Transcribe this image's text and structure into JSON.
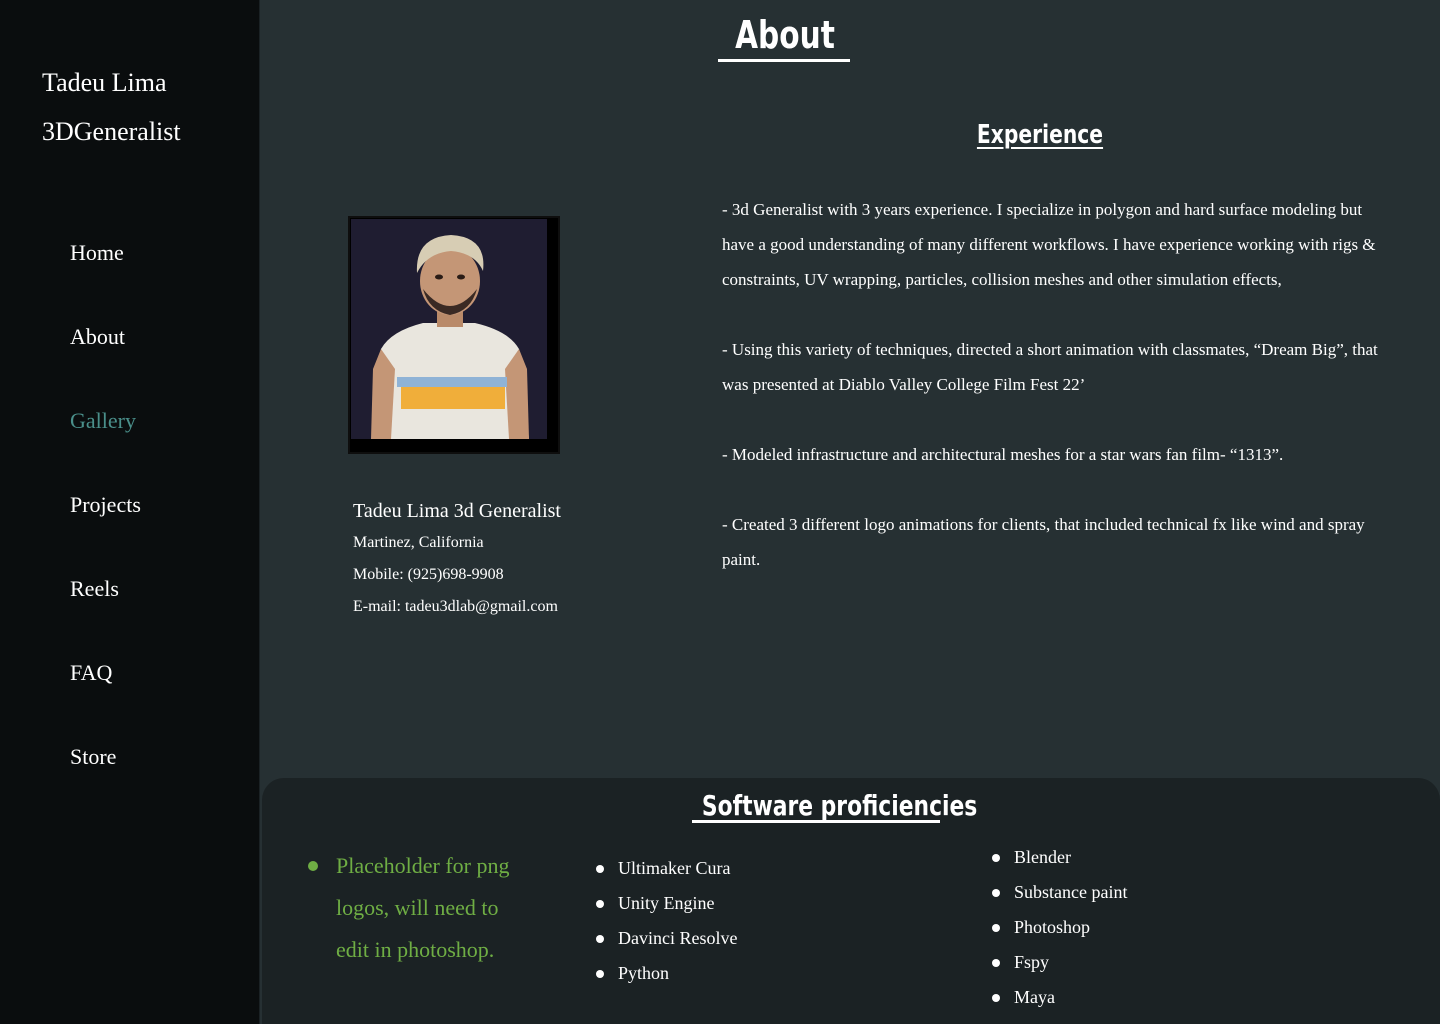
{
  "sidebar": {
    "brand": {
      "name": "Tadeu Lima",
      "tagline": "3DGeneralist"
    },
    "nav": [
      {
        "label": "Home"
      },
      {
        "label": "About"
      },
      {
        "label": "Gallery",
        "active": true
      },
      {
        "label": "Projects"
      },
      {
        "label": "Reels"
      },
      {
        "label": "FAQ"
      },
      {
        "label": "Store"
      }
    ]
  },
  "page": {
    "title": "About"
  },
  "profile": {
    "name": "Tadeu Lima 3d Generalist",
    "location": "Martinez, California",
    "mobile": "Mobile: (925)698-9908",
    "email": "E-mail: tadeu3dlab@gmail.com"
  },
  "experience": {
    "title": "Experience",
    "paragraphs": [
      "- 3d Generalist with 3 years experience. I specialize in polygon and hard surface modeling but have a good understanding of many different workflows. I have experience working with rigs & constraints, UV wrapping, particles, collision meshes and other simulation effects,",
      "- Using this variety of techniques, directed a short animation with classmates, “Dream Big”, that was presented at Diablo Valley College Film Fest 22’",
      "- Modeled infrastructure and architectural meshes for a star wars fan film- “1313”.",
      "- Created 3 different logo animations for clients, that included technical fx like wind and spray paint."
    ]
  },
  "software": {
    "title": "Software proficiencies",
    "placeholder": "Placeholder for png logos, will need to edit in photoshop.",
    "list_middle": [
      "Ultimaker Cura",
      "Unity Engine",
      "Davinci Resolve",
      "Python"
    ],
    "list_right": [
      "Blender",
      "Substance paint",
      "Photoshop",
      "Fspy",
      "Maya"
    ]
  },
  "colors": {
    "sidebar_bg": "#0a0d0e",
    "page_bg": "#263033",
    "panel_bg": "#1b2224",
    "active_nav": "#4a8f8a",
    "placeholder_green": "#6fae44"
  }
}
